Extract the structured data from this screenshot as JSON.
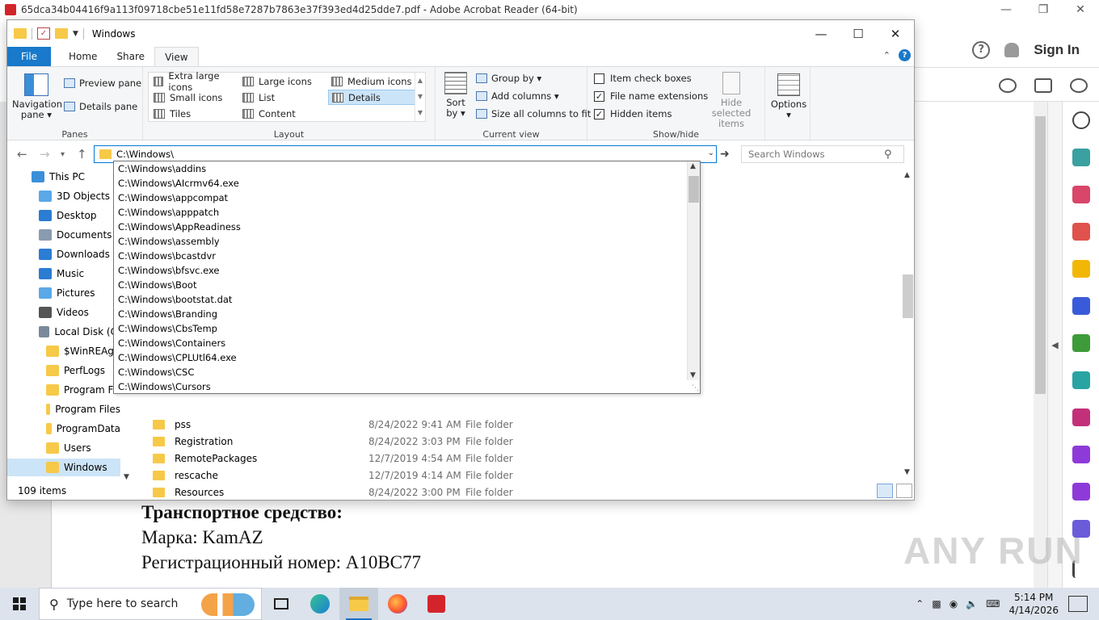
{
  "acrobat": {
    "title": "65dca34b04416f9a113f09718cbe51e11fd58e7287b7863e37f393ed4d25dde7.pdf - Adobe Acrobat Reader (64-bit)",
    "sign_in": "Sign In",
    "help_glyph": "?",
    "pdf_lines": [
      "Транспортное средство:",
      "Марка: KamAZ",
      "Регистрационный номер: A10BC77"
    ],
    "watermark": "ANY RUN"
  },
  "explorer": {
    "title": "Windows",
    "tabs": [
      "File",
      "Home",
      "Share",
      "View"
    ],
    "active_tab": "View",
    "ribbon": {
      "panes": {
        "label": "Panes",
        "navigation_pane": "Navigation pane",
        "preview_pane": "Preview pane",
        "details_pane": "Details pane"
      },
      "layout": {
        "label": "Layout",
        "items": [
          "Extra large icons",
          "Large icons",
          "Medium icons",
          "Small icons",
          "List",
          "Details",
          "Tiles",
          "Content"
        ],
        "selected": "Details"
      },
      "current_view": {
        "label": "Current view",
        "sort_by": "Sort by",
        "group_by": "Group by",
        "add_columns": "Add columns",
        "size_columns": "Size all columns to fit"
      },
      "show_hide": {
        "label": "Show/hide",
        "item_check_boxes": "Item check boxes",
        "file_name_extensions": "File name extensions",
        "hidden_items": "Hidden items",
        "hide_selected": "Hide selected items",
        "checks": {
          "item_check_boxes": false,
          "file_name_extensions": true,
          "hidden_items": true
        }
      },
      "options": "Options"
    },
    "address": "C:\\Windows\\",
    "search_placeholder": "Search Windows",
    "nav_tree": [
      {
        "label": "This PC",
        "icon": "computer-icon",
        "indent": 0
      },
      {
        "label": "3D Objects",
        "icon": "cube-icon",
        "indent": 1
      },
      {
        "label": "Desktop",
        "icon": "desktop-icon",
        "indent": 1
      },
      {
        "label": "Documents",
        "icon": "document-icon",
        "indent": 1
      },
      {
        "label": "Downloads",
        "icon": "download-icon",
        "indent": 1
      },
      {
        "label": "Music",
        "icon": "music-icon",
        "indent": 1
      },
      {
        "label": "Pictures",
        "icon": "pictures-icon",
        "indent": 1
      },
      {
        "label": "Videos",
        "icon": "video-icon",
        "indent": 1
      },
      {
        "label": "Local Disk (C:",
        "icon": "drive-icon",
        "indent": 1
      },
      {
        "label": "$WinREAge",
        "icon": "folder-icon",
        "indent": 2
      },
      {
        "label": "PerfLogs",
        "icon": "folder-icon",
        "indent": 2
      },
      {
        "label": "Program Fil",
        "icon": "folder-icon",
        "indent": 2
      },
      {
        "label": "Program Files",
        "icon": "folder-icon",
        "indent": 2
      },
      {
        "label": "ProgramData",
        "icon": "folder-icon",
        "indent": 2
      },
      {
        "label": "Users",
        "icon": "folder-icon",
        "indent": 2
      },
      {
        "label": "Windows",
        "icon": "folder-icon",
        "indent": 2,
        "selected": true
      }
    ],
    "autocomplete": [
      "C:\\Windows\\addins",
      "C:\\Windows\\AIcrmv64.exe",
      "C:\\Windows\\appcompat",
      "C:\\Windows\\apppatch",
      "C:\\Windows\\AppReadiness",
      "C:\\Windows\\assembly",
      "C:\\Windows\\bcastdvr",
      "C:\\Windows\\bfsvc.exe",
      "C:\\Windows\\Boot",
      "C:\\Windows\\bootstat.dat",
      "C:\\Windows\\Branding",
      "C:\\Windows\\CbsTemp",
      "C:\\Windows\\Containers",
      "C:\\Windows\\CPLUtl64.exe",
      "C:\\Windows\\CSC",
      "C:\\Windows\\Cursors"
    ],
    "files": [
      {
        "name": "pss",
        "date": "8/24/2022 9:41 AM",
        "type": "File folder"
      },
      {
        "name": "Registration",
        "date": "8/24/2022 3:03 PM",
        "type": "File folder"
      },
      {
        "name": "RemotePackages",
        "date": "12/7/2019 4:54 AM",
        "type": "File folder"
      },
      {
        "name": "rescache",
        "date": "12/7/2019 4:14 AM",
        "type": "File folder"
      },
      {
        "name": "Resources",
        "date": "8/24/2022 3:00 PM",
        "type": "File folder"
      }
    ],
    "status": "109 items"
  },
  "taskbar": {
    "search_placeholder": "Type here to search",
    "time": "5:14 PM",
    "date": "4/14/2026"
  },
  "colors": {
    "accent": "#0078d7",
    "file_tab": "#1979ca",
    "folder": "#f7c948",
    "selection": "#cce4f7"
  }
}
